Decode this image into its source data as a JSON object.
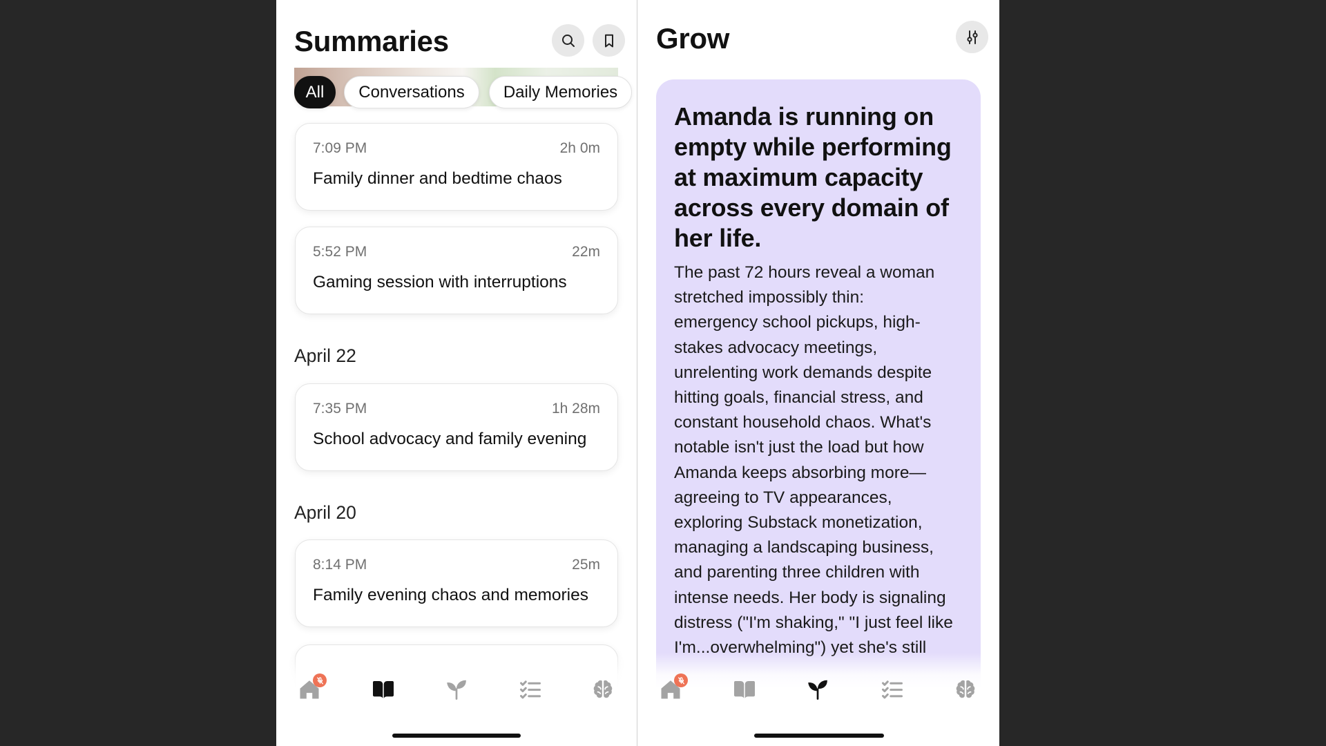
{
  "colors": {
    "page_bg": "#272727",
    "accent": "#111111",
    "inactive_icon": "#a3a3a3",
    "card_purple": "#e3dcfb",
    "badge": "#ee7356",
    "muted_text": "#707070"
  },
  "header_icons": {
    "search": "search-icon",
    "bookmark": "bookmark-icon",
    "grow_settings": "sliders-icon"
  },
  "summaries": {
    "title": "Summaries",
    "filters": [
      {
        "label": "All",
        "selected": true
      },
      {
        "label": "Conversations",
        "selected": false
      },
      {
        "label": "Daily Memories",
        "selected": false
      }
    ],
    "items": [
      {
        "time": "7:09 PM",
        "duration": "2h 0m",
        "title": "Family dinner and bedtime chaos"
      },
      {
        "time": "5:52 PM",
        "duration": "22m",
        "title": "Gaming session with interruptions"
      }
    ],
    "sections": [
      {
        "date": "April 22",
        "items": [
          {
            "time": "7:35 PM",
            "duration": "1h 28m",
            "title": "School advocacy and family evening"
          }
        ]
      },
      {
        "date": "April 20",
        "items": [
          {
            "time": "8:14 PM",
            "duration": "25m",
            "title": "Family evening chaos and memories"
          }
        ]
      }
    ]
  },
  "grow": {
    "title": "Grow",
    "insight": {
      "headline_lines": [
        "Amanda is running on",
        "empty while performing",
        "at maximum capacity",
        "across every domain of",
        "her life."
      ],
      "body_lines": [
        "The past 72 hours reveal a woman",
        "stretched impossibly thin:",
        "emergency school pickups, high-",
        "stakes advocacy meetings,",
        "unrelenting work demands despite",
        "hitting goals, financial stress, and",
        "constant household chaos. What's",
        "notable isn't just the load but how",
        "Amanda keeps absorbing more—",
        "agreeing to TV appearances,",
        "exploring Substack monetization,",
        "managing a landscaping business,",
        "and parenting three children with",
        "intense needs. Her body is signaling",
        "distress (\"I'm shaking,\" \"I just feel like",
        "I'm...overwhelming\") yet she's still"
      ]
    }
  },
  "tab_bar": {
    "items": [
      {
        "icon": "home-icon",
        "badge_icon": "mic-off-icon"
      },
      {
        "icon": "book-icon"
      },
      {
        "icon": "sprout-icon"
      },
      {
        "icon": "checklist-icon"
      },
      {
        "icon": "brain-icon"
      }
    ],
    "summaries_active_index": 1,
    "grow_active_index": 2
  }
}
